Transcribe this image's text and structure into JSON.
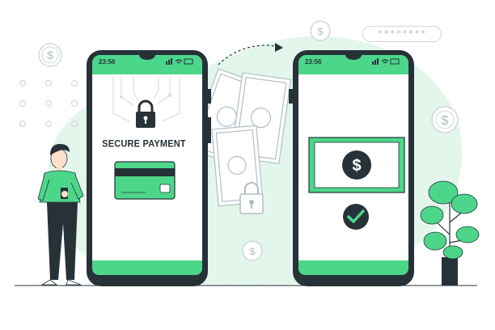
{
  "left_phone": {
    "time": "23:56",
    "label": "SECURE PAYMENT",
    "icons": [
      "padlock-icon",
      "credit-card-icon",
      "signal-icon",
      "wifi-icon",
      "battery-icon"
    ]
  },
  "right_phone": {
    "time": "23:56",
    "icons": [
      "dollar-banknote-icon",
      "checkmark-icon",
      "signal-icon",
      "wifi-icon",
      "battery-icon"
    ]
  },
  "password_field": {
    "value": "********"
  },
  "colors": {
    "accent": "#4cd68a",
    "accent_light": "#dcf5e6",
    "dark": "#263238",
    "outline": "#b0bec5"
  }
}
